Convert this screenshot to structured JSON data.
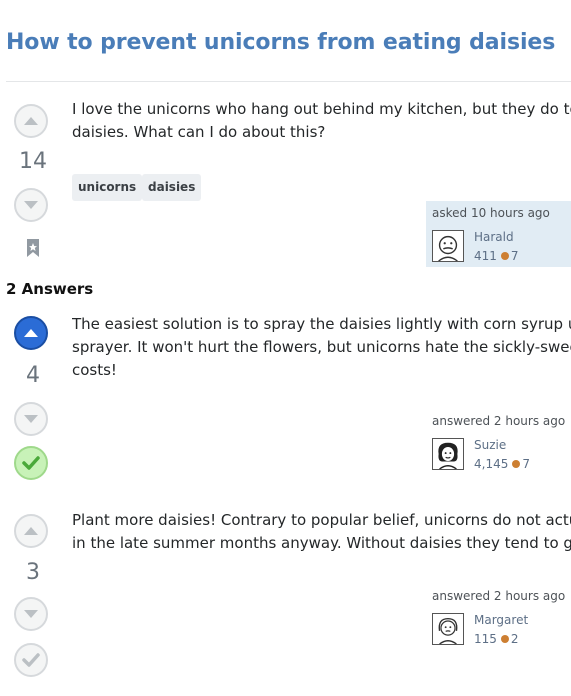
{
  "question": {
    "title": "How to prevent unicorns from eating daisies",
    "body_lines": [
      "I love the unicorns who hang out behind my kitchen, but they do te",
      "daisies. What can I do about this?"
    ],
    "score": "14",
    "tags": [
      "unicorns",
      "daisies"
    ],
    "asker": {
      "action": "asked 10 hours ago",
      "name": "Harald",
      "reputation": "411",
      "bronze": "7"
    }
  },
  "answers_header": "2 Answers",
  "answers": [
    {
      "score": "4",
      "upvoted": true,
      "accepted": true,
      "body_lines": [
        "The easiest solution is to spray the daisies lightly with corn syrup us",
        "sprayer. It won't hurt the flowers, but unicorns hate the sickly-sweet",
        "costs!"
      ],
      "author": {
        "action": "answered 2 hours ago",
        "name": "Suzie",
        "reputation": "4,145",
        "bronze": "7"
      }
    },
    {
      "score": "3",
      "upvoted": false,
      "accepted": false,
      "body_lines": [
        "Plant more daisies! Contrary to popular belief, unicorns do not actu",
        "in the late summer months anyway. Without daisies they tend to ge"
      ],
      "author": {
        "action": "answered 2 hours ago",
        "name": "Margaret",
        "reputation": "115",
        "bronze": "2"
      }
    }
  ],
  "colors": {
    "title": "#4a7db8",
    "upvote_active": "#2b6cd6",
    "accepted": "#c8f2b8",
    "asker_card": "#e1ecf4",
    "bronze": "#cd7f32"
  }
}
